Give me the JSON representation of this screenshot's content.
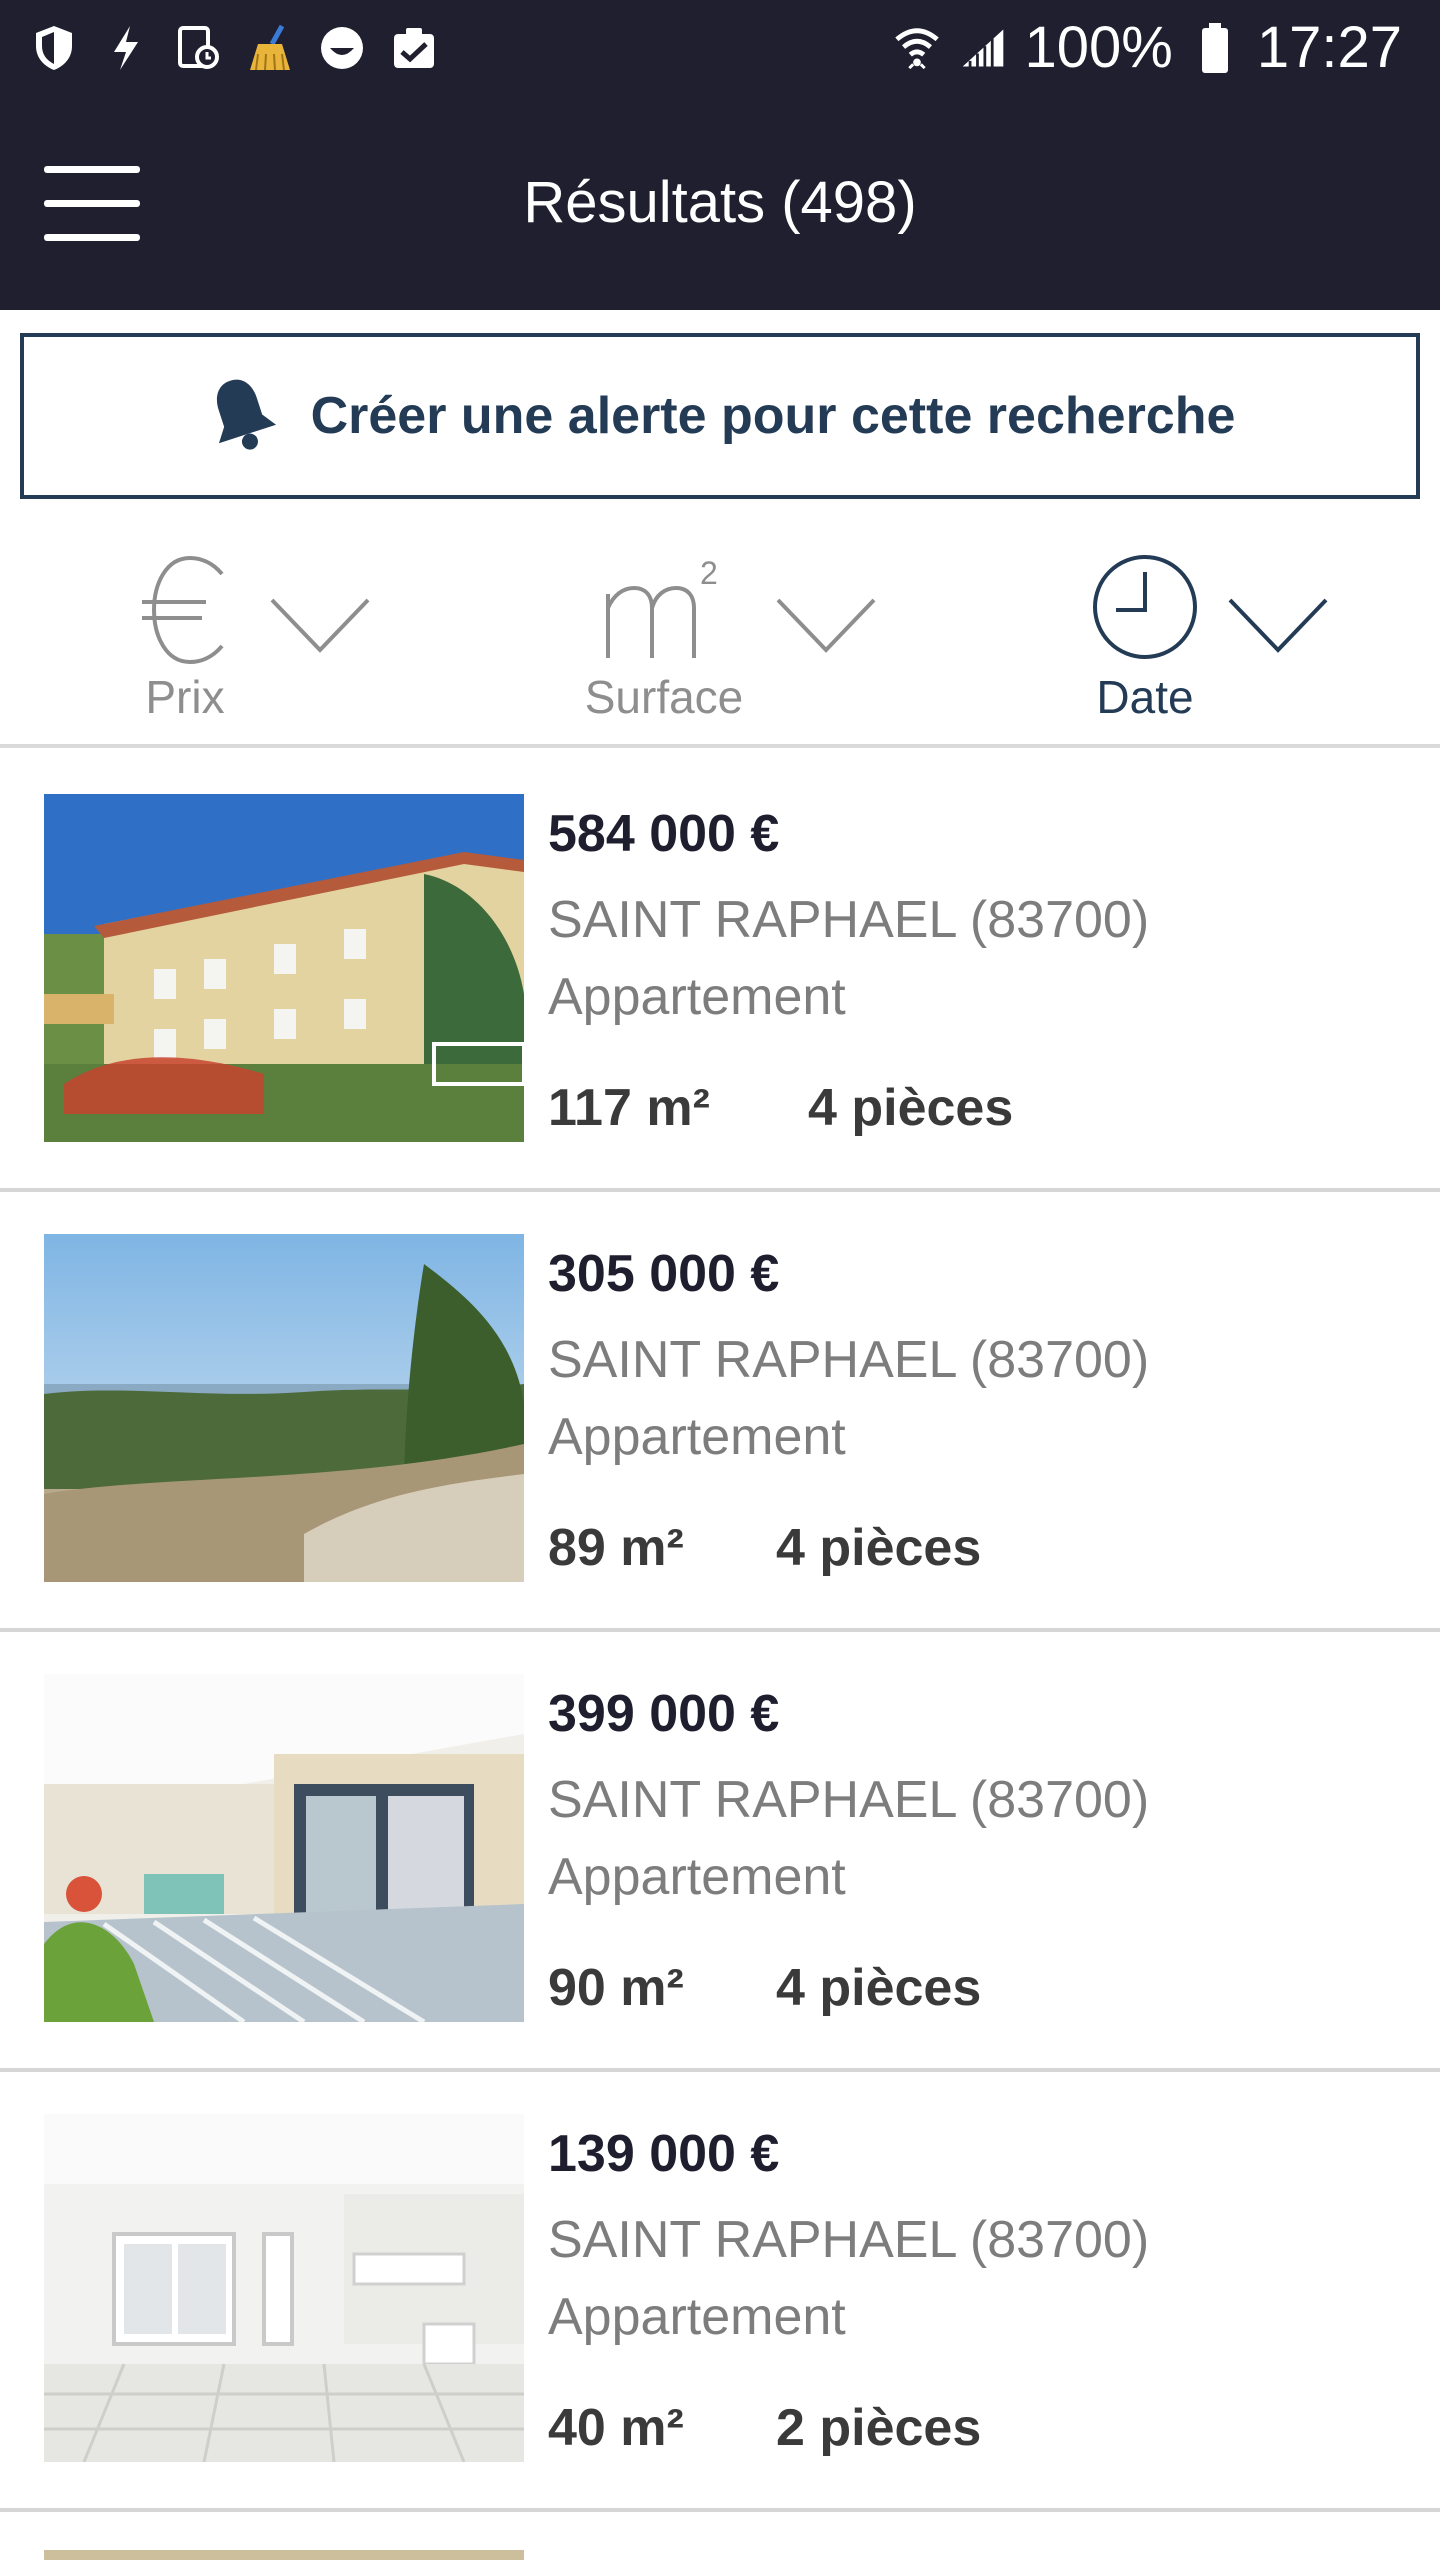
{
  "status_bar": {
    "left_icons": [
      "shield-icon",
      "bolt-icon",
      "alarm-doc-icon",
      "broom-icon",
      "smiley-icon",
      "clipboard-check-icon"
    ],
    "right_icons": [
      "wifi-icon",
      "signal-icon",
      "battery-icon"
    ],
    "battery_percent": "100%",
    "time": "17:27"
  },
  "header": {
    "title": "Résultats (498)",
    "menu_icon": "hamburger-menu-icon",
    "background": "#1f1f2f"
  },
  "alert": {
    "label": "Créer une alerte pour cette recherche",
    "icon": "bell-icon",
    "color": "#243b56"
  },
  "sort": {
    "items": [
      {
        "label": "Prix",
        "icon": "euro-icon",
        "active": false
      },
      {
        "label": "Surface",
        "icon": "square-meter-icon",
        "active": false
      },
      {
        "label": "Date",
        "icon": "clock-icon",
        "active": true
      }
    ],
    "active_color": "#243b56",
    "inactive_color": "#8e8e8e"
  },
  "listings": [
    {
      "price": "584 000 €",
      "city": "SAINT RAPHAEL (83700)",
      "type": "Appartement",
      "area": "117 m²",
      "rooms": "4 pièces",
      "photo": "apartment-building-photo"
    },
    {
      "price": "305 000 €",
      "city": "SAINT RAPHAEL (83700)",
      "type": "Appartement",
      "area": "89 m²",
      "rooms": "4 pièces",
      "photo": "hillside-view-photo"
    },
    {
      "price": "399 000 €",
      "city": "SAINT RAPHAEL (83700)",
      "type": "Appartement",
      "area": "90 m²",
      "rooms": "4 pièces",
      "photo": "terrace-photo"
    },
    {
      "price": "139 000 €",
      "city": "SAINT RAPHAEL (83700)",
      "type": "Appartement",
      "area": "40 m²",
      "rooms": "2 pièces",
      "photo": "empty-room-photo"
    }
  ]
}
